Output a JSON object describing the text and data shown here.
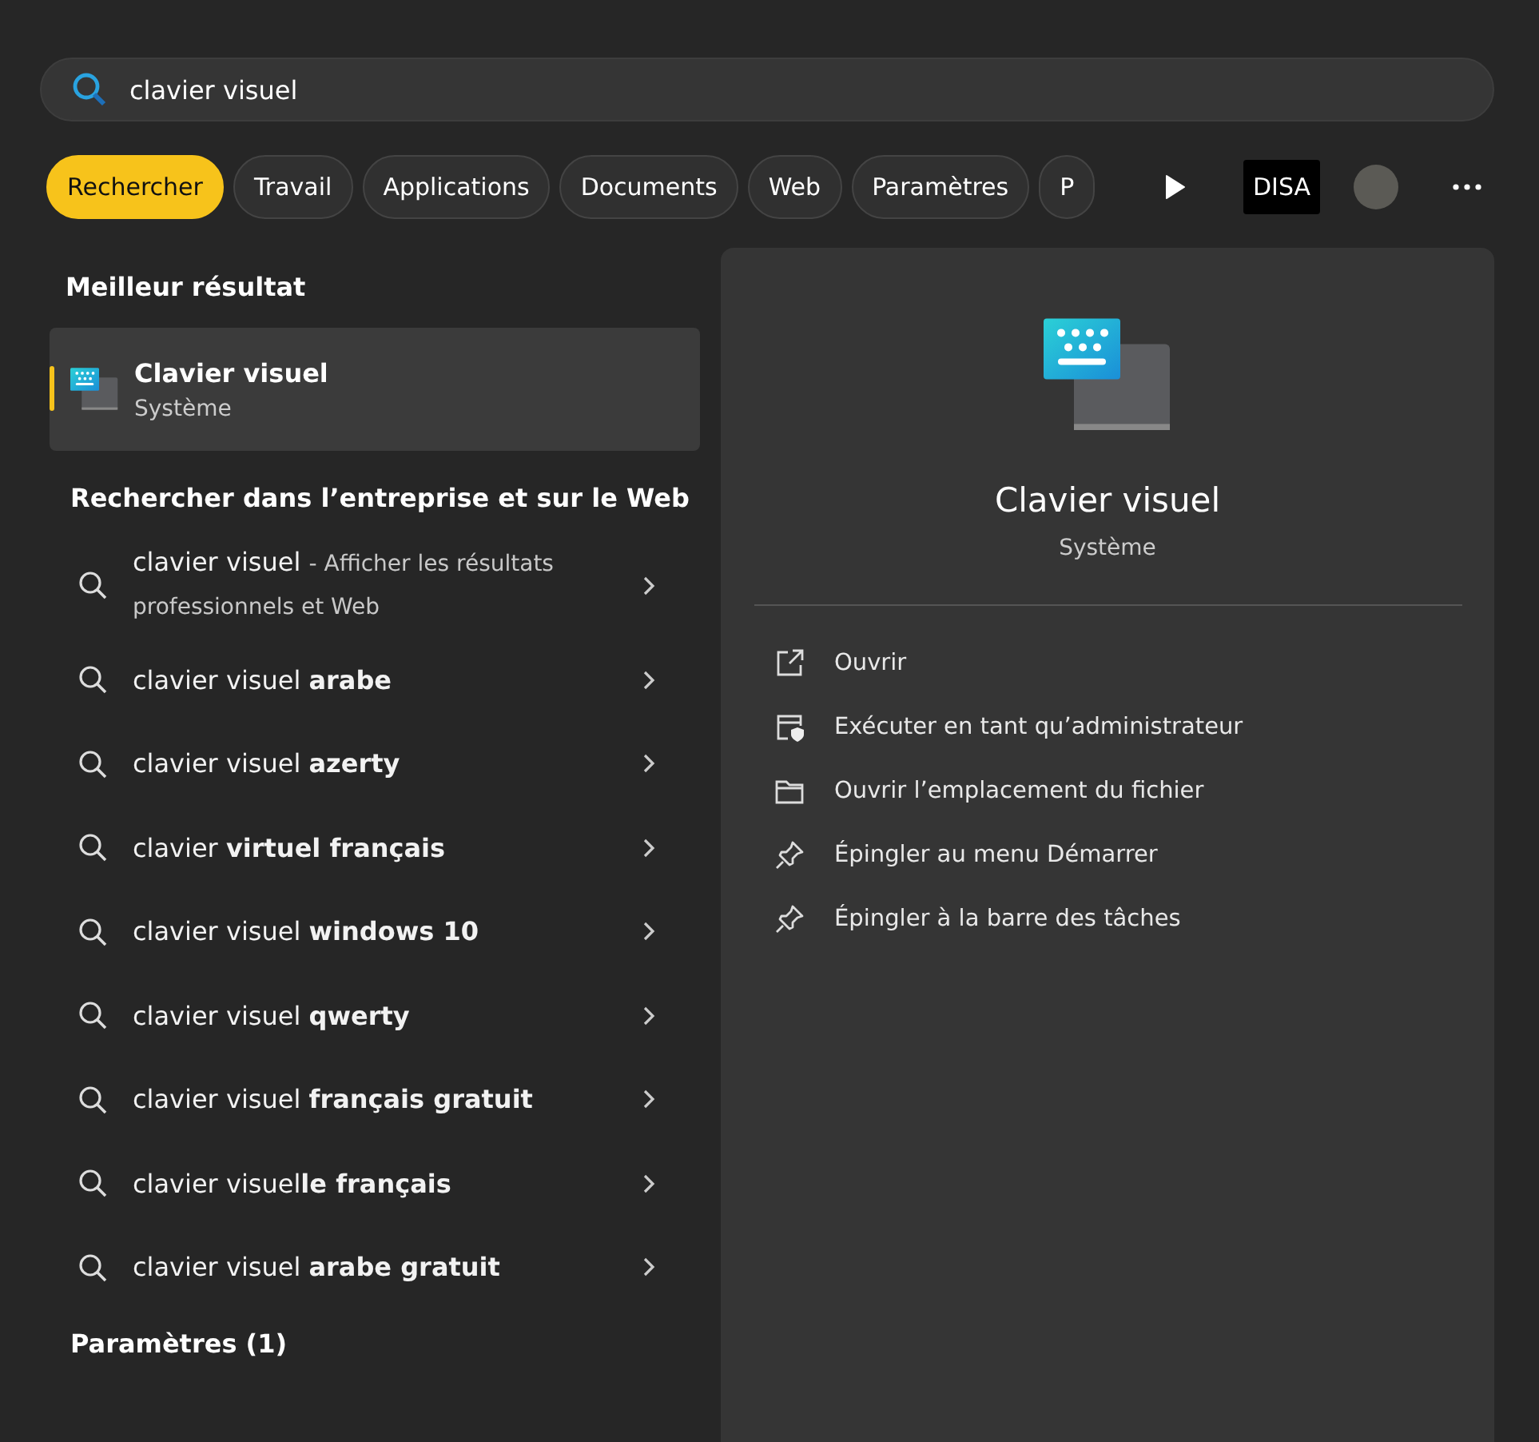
{
  "search": {
    "value": "clavier visuel"
  },
  "tabs": [
    {
      "label": "Rechercher",
      "selected": true
    },
    {
      "label": "Travail",
      "selected": false
    },
    {
      "label": "Applications",
      "selected": false
    },
    {
      "label": "Documents",
      "selected": false
    },
    {
      "label": "Web",
      "selected": false
    },
    {
      "label": "Paramètres",
      "selected": false
    },
    {
      "label": "P",
      "selected": false
    }
  ],
  "account": {
    "badge": "DISA"
  },
  "best_match": {
    "heading": "Meilleur résultat",
    "title": "Clavier visuel",
    "subtitle": "Système",
    "selected": true
  },
  "web_section": {
    "heading": "Rechercher dans l’entreprise et sur le Web",
    "suggestions": [
      {
        "text": "clavier visuel",
        "hint": "- Afficher les résultats professionnels et Web"
      },
      {
        "text": "clavier visuel **arabe**"
      },
      {
        "text": "clavier visuel **azerty**"
      },
      {
        "text": "clavier **virtuel français**"
      },
      {
        "text": "clavier visuel **windows 10**"
      },
      {
        "text": "clavier visuel **qwerty**"
      },
      {
        "text": "clavier visuel **français gratuit**"
      },
      {
        "text": "clavier visuel**le français**"
      },
      {
        "text": "clavier visuel **arabe gratuit**"
      }
    ]
  },
  "settings_section": {
    "heading": "Paramètres (1)"
  },
  "detail": {
    "title": "Clavier visuel",
    "subtitle": "Système",
    "actions": [
      {
        "kind": "open",
        "label": "Ouvrir"
      },
      {
        "kind": "admin",
        "label": "Exécuter en tant qu’administrateur"
      },
      {
        "kind": "folder",
        "label": "Ouvrir l’emplacement du fichier"
      },
      {
        "kind": "pin",
        "label": "Épingler au menu Démarrer"
      },
      {
        "kind": "pin",
        "label": "Épingler à la barre des tâches"
      }
    ]
  }
}
